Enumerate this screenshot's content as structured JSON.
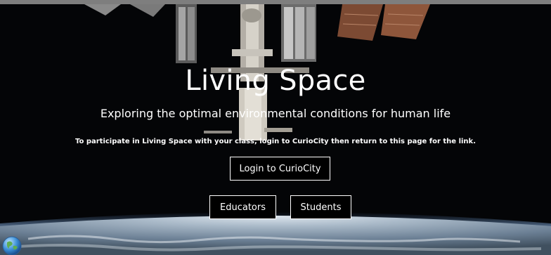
{
  "hero": {
    "title": "Living Space",
    "subtitle": "Exploring the optimal environmental conditions for human life",
    "note": "To participate in Living Space with your class, login to CurioCity then return to this page for the link."
  },
  "buttons": {
    "login": "Login to CurioCity",
    "educators": "Educators",
    "students": "Students"
  },
  "icons": {
    "background": "space-station-earth-image",
    "corner": "globe-icon"
  },
  "colors": {
    "text": "#ffffff",
    "button_bg": "#000000",
    "button_border": "#ffffff",
    "space": "#040507"
  }
}
